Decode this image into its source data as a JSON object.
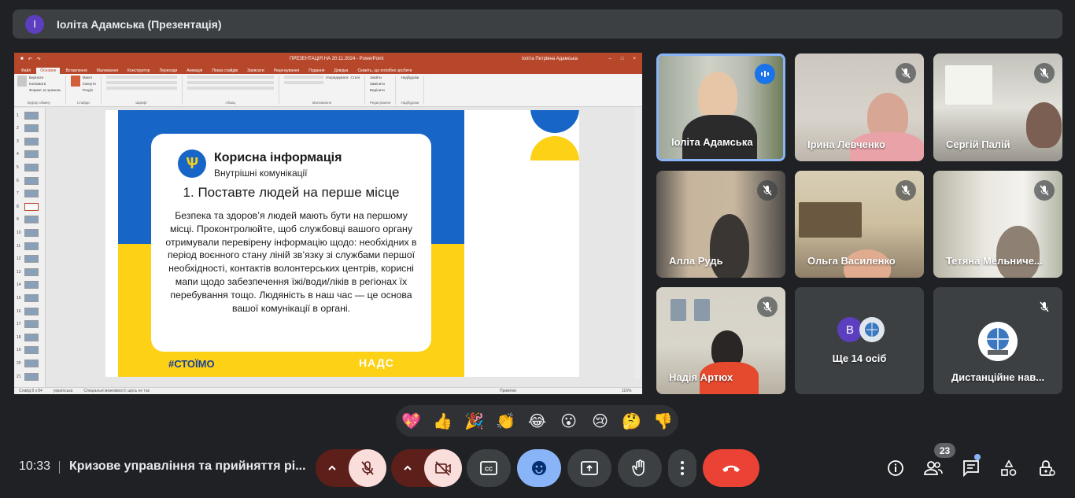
{
  "presenter": {
    "avatar_letter": "I",
    "title": "Іоліта Адамська (Презентація)"
  },
  "powerpoint": {
    "window_title": "ПРЕЗЕНТАЦІЯ НА 20.11.2024 - PowerPoint",
    "user": "Іоліта Петрівна Адамська",
    "tabs": [
      "Файл",
      "Основне",
      "Вставлення",
      "Малювання",
      "Конструктор",
      "Переходи",
      "Анімація",
      "Показ слайдів",
      "Записати",
      "Рецензування",
      "Подання",
      "Довідка",
      "Скажіть, що потрібно зробити"
    ],
    "ribbon_groups": [
      "Буфер обміну",
      "Слайди",
      "Шрифт",
      "Абзац",
      "Малювання",
      "Редагування",
      "Надбудови"
    ],
    "ribbon_items": {
      "paste": "Вставити",
      "cut": "Вирізати",
      "copy": "Копіювати",
      "format_painter": "Формат за зразком",
      "new_slide": "Створити слайд",
      "layout": "Макет",
      "reset": "Скинути",
      "section": "Розділ",
      "arrange": "Упорядкувати",
      "quick_styles": "Стилі",
      "find": "Знайти",
      "replace": "Замінити",
      "select": "Виділити",
      "addins": "Надбудови"
    },
    "thumbnails": [
      "1",
      "2",
      "3",
      "4",
      "5",
      "6",
      "7",
      "8",
      "9",
      "10",
      "11",
      "12",
      "13",
      "14",
      "15",
      "16",
      "17",
      "18",
      "19",
      "20",
      "21"
    ],
    "active_thumbnail": 8,
    "status": {
      "slide": "Слайд 8 з 84",
      "language": "українська",
      "accessibility": "Спеціальні можливості: щось не так",
      "notes": "Примітки",
      "zoom": "116%"
    },
    "slide": {
      "title": "Корисна інформація",
      "subtitle": "Внутрішні комунікації",
      "heading": "1. Поставте людей на перше місце",
      "body": "Безпека та здоров’я людей мають бути на першому місці. Проконтролюйте, щоб службовці вашого органу отримували перевірену інформацію щодо: необхідних в період воєнного стану ліній зв’язку зі службами першої необхідності, контактів волонтерських центрів, корисні мапи щодо забезпечення їжі/води/ліків в регіонах їх перебування тощо. Людяність в наш час — це основа вашої комунікації в органі.",
      "hashtag": "#СТОЇМО",
      "brand": "НАДС",
      "colors": {
        "blue": "#1765c7",
        "yellow": "#fcd116"
      }
    }
  },
  "participants": [
    {
      "name": "Іоліта Адамська",
      "state": "speaking"
    },
    {
      "name": "Ірина Левченко",
      "state": "muted"
    },
    {
      "name": "Сергій Палій",
      "state": "muted"
    },
    {
      "name": "Алла Рудь",
      "state": "muted"
    },
    {
      "name": "Ольга Василенко",
      "state": "muted"
    },
    {
      "name": "Тетяна Мельниче...",
      "state": "muted"
    },
    {
      "name": "Надія Артюх",
      "state": "muted"
    },
    {
      "name": "Ще 14 осіб",
      "avatar_letter": "B",
      "state": "group"
    },
    {
      "name": "Дистанційне нав...",
      "state": "muted"
    }
  ],
  "reactions": [
    "💖",
    "👍",
    "🎉",
    "👏",
    "😂",
    "😮",
    "😢",
    "🤔",
    "👎"
  ],
  "bottom_bar": {
    "time": "10:33",
    "meeting_title": "Кризове управління та прийняття рі...",
    "people_count": "23",
    "icons": [
      "chevron-up-icon",
      "mic-off-icon",
      "chevron-up-icon",
      "camera-off-icon",
      "captions-icon",
      "emoji-icon",
      "present-icon",
      "raise-hand-icon",
      "more-icon",
      "end-call-icon",
      "info-icon",
      "people-icon",
      "chat-icon",
      "activities-icon",
      "host-controls-icon"
    ],
    "colors": {
      "end": "#ea4335",
      "mic_off_bg": "#f9dedc",
      "active_blue": "#8ab4f8"
    }
  }
}
